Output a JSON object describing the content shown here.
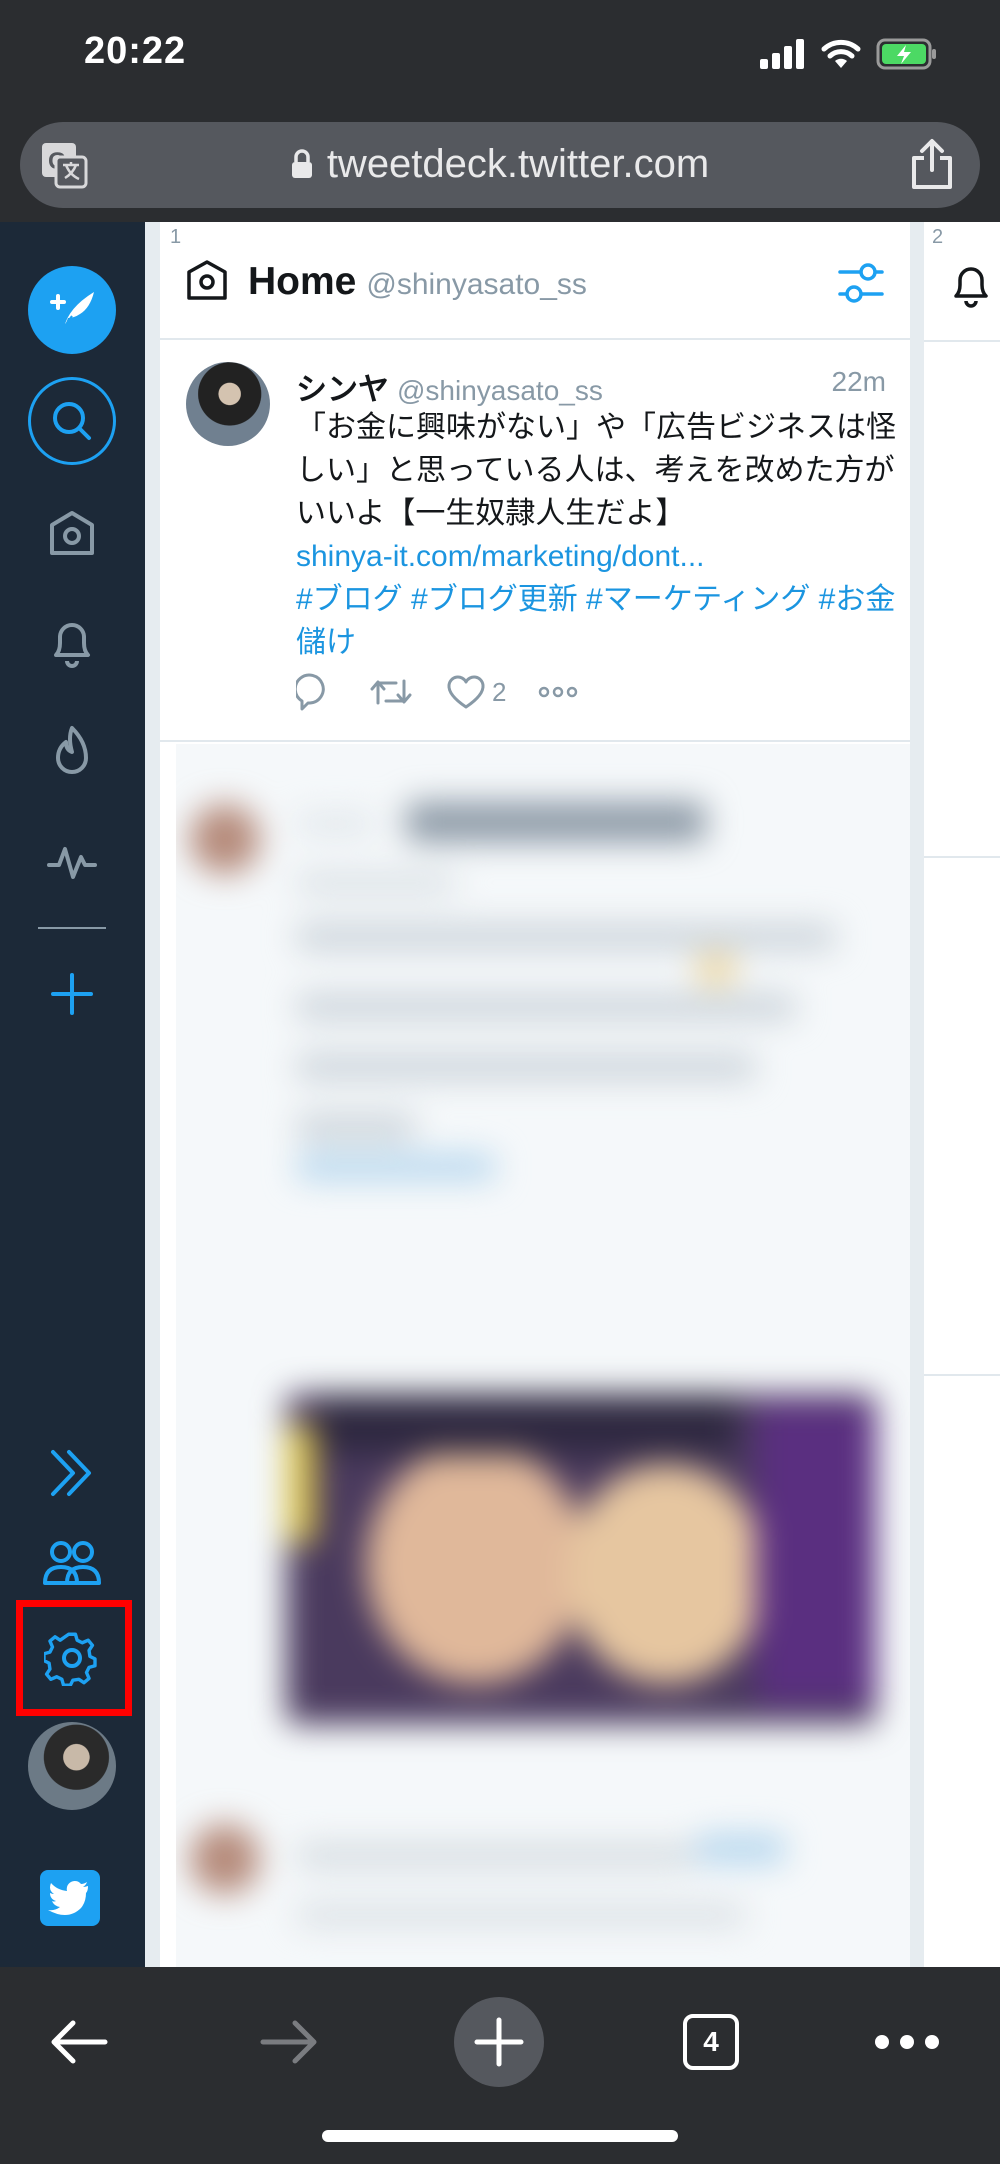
{
  "status_bar": {
    "time": "20:22"
  },
  "browser": {
    "url": "tweetdeck.twitter.com",
    "tab_count": "4"
  },
  "sidebar": {
    "icons": [
      "compose-icon",
      "search-icon",
      "home-icon",
      "notifications-icon",
      "trending-icon",
      "activity-icon",
      "add-column-icon",
      "expand-icon",
      "accounts-icon",
      "settings-icon"
    ]
  },
  "columns": [
    {
      "number": "1",
      "title": "Home",
      "handle": "@shinyasato_ss"
    },
    {
      "number": "2"
    }
  ],
  "tweet": {
    "author": "シンヤ",
    "handle": "@shinyasato_ss",
    "time": "22m",
    "text": "「お金に興味がない」や「広告ビジネスは怪しい」と思っている人は、考えを改めた方がいいよ【一生奴隷人生だよ】",
    "link": "shinya-it.com/marketing/dont...",
    "hashtags": "#ブログ #ブログ更新 #マーケティング #お金儲け",
    "like_count": "2"
  },
  "colors": {
    "accent": "#1da1f2",
    "sidebar": "#1c2938",
    "highlight": "#ff0000"
  }
}
